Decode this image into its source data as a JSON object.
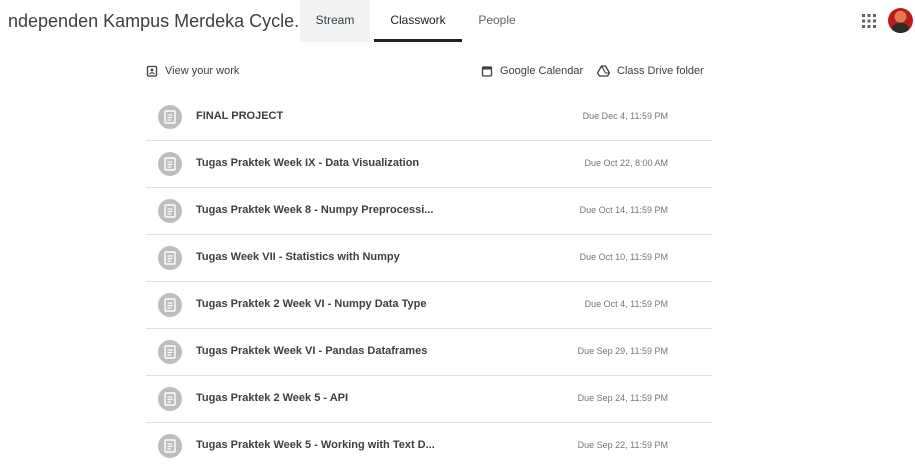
{
  "header": {
    "class_title": "ndependen Kampus Merdeka Cycle...",
    "tabs": [
      {
        "label": "Stream"
      },
      {
        "label": "Classwork"
      },
      {
        "label": "People"
      }
    ]
  },
  "toolbar": {
    "view_work": "View your work",
    "google_calendar": "Google Calendar",
    "drive_folder": "Class Drive folder"
  },
  "assignments": [
    {
      "title": "FINAL PROJECT",
      "due": "Due Dec 4, 11:59 PM"
    },
    {
      "title": "Tugas Praktek Week IX - Data Visualization",
      "due": "Due Oct 22, 8:00 AM"
    },
    {
      "title": "Tugas Praktek Week 8 - Numpy Preprocessi...",
      "due": "Due Oct 14, 11:59 PM"
    },
    {
      "title": "Tugas Week VII - Statistics with Numpy",
      "due": "Due Oct 10, 11:59 PM"
    },
    {
      "title": "Tugas Praktek 2 Week VI - Numpy Data Type",
      "due": "Due Oct 4, 11:59 PM"
    },
    {
      "title": "Tugas Praktek Week VI - Pandas Dataframes",
      "due": "Due Sep 29, 11:59 PM"
    },
    {
      "title": "Tugas Praktek 2 Week 5 - API",
      "due": "Due Sep 24, 11:59 PM"
    },
    {
      "title": "Tugas Praktek Week 5 - Working with Text D...",
      "due": "Due Sep 22, 11:59 PM"
    }
  ],
  "icons": {
    "apps": "apps-grid-icon",
    "assignment": "assignment-icon",
    "view_work": "assignment-ind-icon",
    "calendar": "calendar-icon",
    "drive": "drive-icon"
  },
  "colors": {
    "active_tab_underline": "#202124",
    "assignment_badge": "#bdbdbd",
    "divider": "#e0e0e0"
  }
}
